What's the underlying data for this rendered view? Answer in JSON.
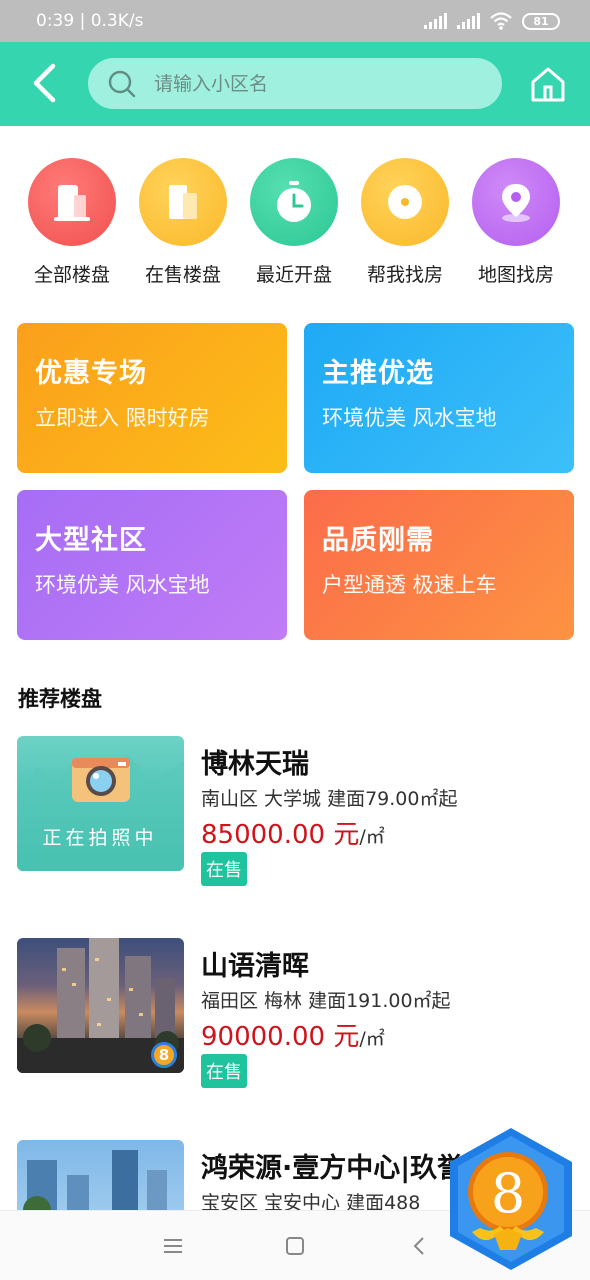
{
  "status": {
    "time_speed": "0:39 | 0.3K/s",
    "battery": "81"
  },
  "header": {
    "search_placeholder": "请输入小区名"
  },
  "categories": [
    {
      "label": "全部楼盘",
      "icon": "building-icon",
      "color": "#f0504f"
    },
    {
      "label": "在售楼盘",
      "icon": "on-sale-building-icon",
      "color": "#fbb82a"
    },
    {
      "label": "最近开盘",
      "icon": "timer-icon",
      "color": "#2cc795"
    },
    {
      "label": "帮我找房",
      "icon": "search-house-icon",
      "color": "#fbb82a"
    },
    {
      "label": "地图找房",
      "icon": "map-pin-icon",
      "color": "#b45ff0"
    }
  ],
  "promos": [
    {
      "title": "优惠专场",
      "subtitle": "立即进入 限时好房",
      "color": "#fba51a"
    },
    {
      "title": "主推优选",
      "subtitle": "环境优美 风水宝地",
      "color": "#2bb4f7"
    },
    {
      "title": "大型社区",
      "subtitle": "环境优美 风水宝地",
      "color": "#b06ff5"
    },
    {
      "title": "品质刚需",
      "subtitle": "户型通透 极速上车",
      "color": "#fc7745"
    }
  ],
  "section_title": "推荐楼盘",
  "listings": [
    {
      "name": "博林天瑞",
      "desc": "南山区 大学城 建面79.00㎡起",
      "price": "85000.00 元",
      "unit": "/㎡",
      "tag": "在售",
      "thumb_text": "正在拍照中"
    },
    {
      "name": "山语清晖",
      "desc": "福田区 梅林 建面191.00㎡起",
      "price": "90000.00 元",
      "unit": "/㎡",
      "tag": "在售"
    },
    {
      "name": "鸿荣源·壹方中心|玖誉",
      "desc": "宝安区 宝安中心 建面488",
      "price": "",
      "unit": "",
      "tag": ""
    }
  ],
  "floating_badge": {
    "number": "8"
  },
  "small_badge": {
    "number": "8"
  }
}
